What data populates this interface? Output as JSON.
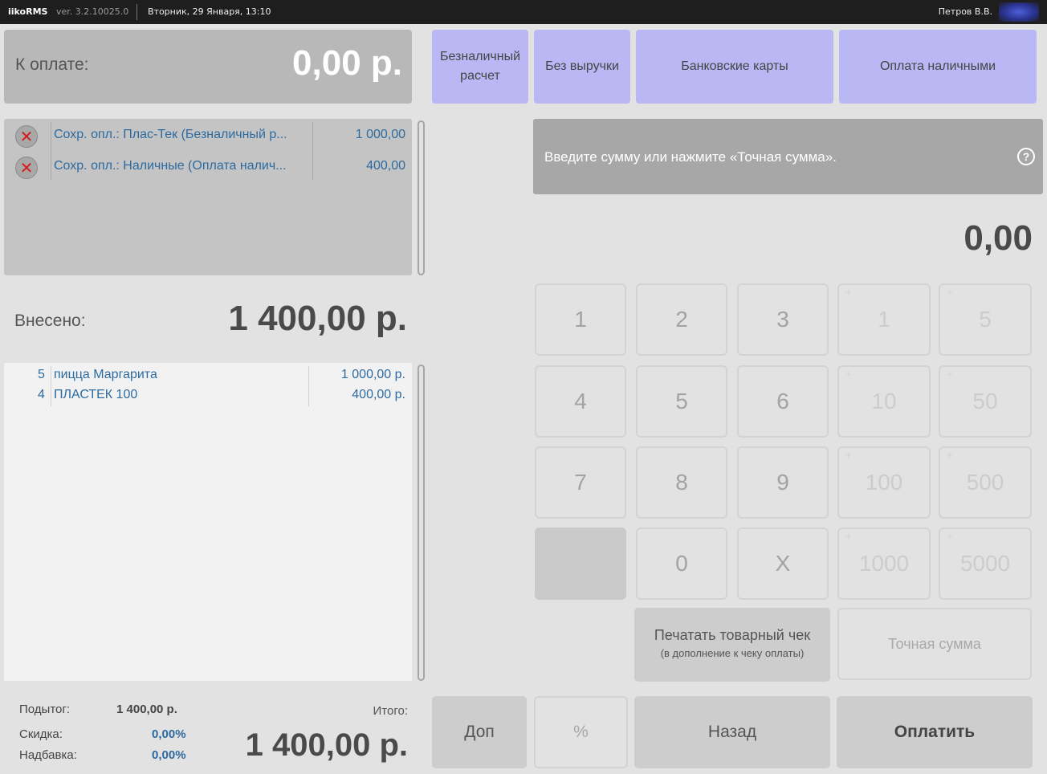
{
  "topbar": {
    "brand": "iikoRMS",
    "version": "ver. 3.2.10025.0",
    "date": "Вторник, 29 Января, 13:10",
    "user": "Петров В.В."
  },
  "to_pay": {
    "label": "К оплате:",
    "value": "0,00 р."
  },
  "payment_types": [
    "Безналичный расчет",
    "Без выручки",
    "Банковские карты",
    "Оплата наличными"
  ],
  "saved_payments": [
    {
      "label": "Сохр. опл.: Плас-Тек (Безналичный р...",
      "amount": "1 000,00"
    },
    {
      "label": "Сохр. опл.: Наличные (Оплата налич...",
      "amount": "400,00"
    }
  ],
  "prompt": {
    "text": "Введите сумму или нажмите «Точная сумма».",
    "help": "?"
  },
  "entry_value": "0,00",
  "deposited": {
    "label": "Внесено:",
    "value": "1 400,00 р."
  },
  "order_items": [
    {
      "qty": "5",
      "name": "пицца Маргарита",
      "amount": "1 000,00 р."
    },
    {
      "qty": "4",
      "name": "ПЛАСТЕК 100",
      "amount": "400,00 р."
    }
  ],
  "keypad": {
    "digits": [
      "1",
      "2",
      "3",
      "4",
      "5",
      "6",
      "7",
      "8",
      "9",
      "0",
      "X"
    ],
    "quick": [
      "1",
      "5",
      "10",
      "50",
      "100",
      "500",
      "1000",
      "5000"
    ],
    "plus": "+"
  },
  "print_receipt": {
    "title": "Печатать товарный чек",
    "subtitle": "(в дополнение к чеку оплаты)"
  },
  "exact_amount": "Точная сумма",
  "bottom_buttons": {
    "more": "Доп",
    "percent": "%",
    "back": "Назад",
    "pay": "Оплатить"
  },
  "totals": {
    "subtotal_label": "Подытог:",
    "subtotal": "1 400,00 р.",
    "discount_label": "Скидка:",
    "discount": "0,00%",
    "surcharge_label": "Надбавка:",
    "surcharge": "0,00%",
    "total_label": "Итого:",
    "total": "1 400,00 р."
  }
}
